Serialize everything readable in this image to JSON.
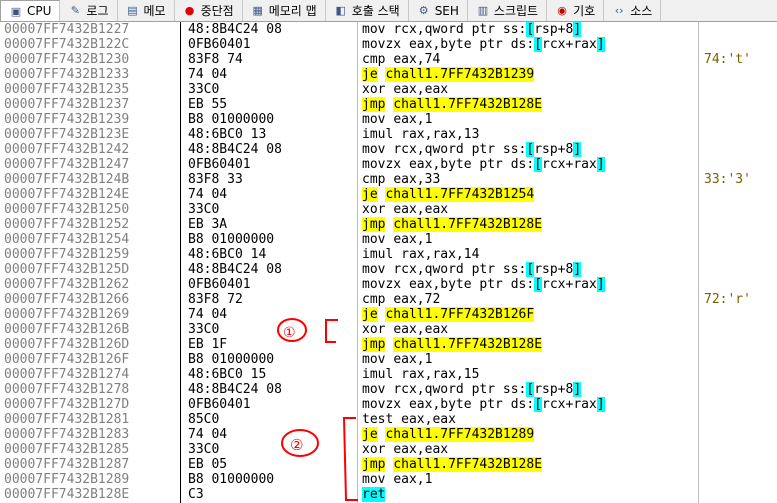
{
  "tabs": [
    {
      "label": "CPU",
      "icon": "cpu-icon",
      "active": true
    },
    {
      "label": "로그",
      "icon": "log-icon"
    },
    {
      "label": "메모",
      "icon": "notes-icon"
    },
    {
      "label": "중단점",
      "icon": "breakpoint-icon"
    },
    {
      "label": "메모리 맵",
      "icon": "memory-map-icon"
    },
    {
      "label": "호출 스택",
      "icon": "call-stack-icon"
    },
    {
      "label": "SEH",
      "icon": "seh-icon"
    },
    {
      "label": "스크립트",
      "icon": "script-icon"
    },
    {
      "label": "기호",
      "icon": "symbols-icon"
    },
    {
      "label": "소스",
      "icon": "source-icon"
    }
  ],
  "colors": {
    "highlight": "#ffff00",
    "bracket": "#00ffff",
    "annotation": "#ff0000"
  },
  "annotations": {
    "mark1": "①",
    "mark2": "②"
  },
  "rows": [
    {
      "addr": "00007FF7432B1227",
      "bytes": "48:8B4C24 08",
      "m": "mov",
      "ops": [
        [
          "rcx,qword ptr ss:",
          ""
        ],
        [
          "[",
          "br"
        ],
        [
          "rsp+8",
          ""
        ],
        [
          "]",
          "br"
        ]
      ],
      "cmt": ""
    },
    {
      "addr": "00007FF7432B122C",
      "bytes": "0FB60401",
      "m": "movzx",
      "ops": [
        [
          "eax,byte ptr ds:",
          ""
        ],
        [
          "[",
          "br"
        ],
        [
          "rcx+rax",
          ""
        ],
        [
          "]",
          "br"
        ]
      ],
      "cmt": ""
    },
    {
      "addr": "00007FF7432B1230",
      "bytes": "83F8 74",
      "m": "cmp",
      "ops": [
        [
          "eax,74",
          ""
        ]
      ],
      "cmt": "74:'t'"
    },
    {
      "addr": "00007FF7432B1233",
      "bytes": "74 04",
      "m": "je",
      "jmp": true,
      "ops": [
        [
          "chall1.7FF7432B1239",
          "tgt"
        ]
      ],
      "cmt": ""
    },
    {
      "addr": "00007FF7432B1235",
      "bytes": "33C0",
      "m": "xor",
      "ops": [
        [
          "eax,eax",
          ""
        ]
      ],
      "cmt": ""
    },
    {
      "addr": "00007FF7432B1237",
      "bytes": "EB 55",
      "m": "jmp",
      "jmp": true,
      "ops": [
        [
          "chall1.7FF7432B128E",
          "tgt"
        ]
      ],
      "cmt": ""
    },
    {
      "addr": "00007FF7432B1239",
      "bytes": "B8 01000000",
      "m": "mov",
      "ops": [
        [
          "eax,1",
          ""
        ]
      ],
      "cmt": ""
    },
    {
      "addr": "00007FF7432B123E",
      "bytes": "48:6BC0 13",
      "m": "imul",
      "ops": [
        [
          "rax,rax,13",
          ""
        ]
      ],
      "cmt": ""
    },
    {
      "addr": "00007FF7432B1242",
      "bytes": "48:8B4C24 08",
      "m": "mov",
      "ops": [
        [
          "rcx,qword ptr ss:",
          ""
        ],
        [
          "[",
          "br"
        ],
        [
          "rsp+8",
          ""
        ],
        [
          "]",
          "br"
        ]
      ],
      "cmt": ""
    },
    {
      "addr": "00007FF7432B1247",
      "bytes": "0FB60401",
      "m": "movzx",
      "ops": [
        [
          "eax,byte ptr ds:",
          ""
        ],
        [
          "[",
          "br"
        ],
        [
          "rcx+rax",
          ""
        ],
        [
          "]",
          "br"
        ]
      ],
      "cmt": ""
    },
    {
      "addr": "00007FF7432B124B",
      "bytes": "83F8 33",
      "m": "cmp",
      "ops": [
        [
          "eax,33",
          ""
        ]
      ],
      "cmt": "33:'3'"
    },
    {
      "addr": "00007FF7432B124E",
      "bytes": "74 04",
      "m": "je",
      "jmp": true,
      "ops": [
        [
          "chall1.7FF7432B1254",
          "tgt"
        ]
      ],
      "cmt": ""
    },
    {
      "addr": "00007FF7432B1250",
      "bytes": "33C0",
      "m": "xor",
      "ops": [
        [
          "eax,eax",
          ""
        ]
      ],
      "cmt": ""
    },
    {
      "addr": "00007FF7432B1252",
      "bytes": "EB 3A",
      "m": "jmp",
      "jmp": true,
      "ops": [
        [
          "chall1.7FF7432B128E",
          "tgt"
        ]
      ],
      "cmt": ""
    },
    {
      "addr": "00007FF7432B1254",
      "bytes": "B8 01000000",
      "m": "mov",
      "ops": [
        [
          "eax,1",
          ""
        ]
      ],
      "cmt": ""
    },
    {
      "addr": "00007FF7432B1259",
      "bytes": "48:6BC0 14",
      "m": "imul",
      "ops": [
        [
          "rax,rax,14",
          ""
        ]
      ],
      "cmt": ""
    },
    {
      "addr": "00007FF7432B125D",
      "bytes": "48:8B4C24 08",
      "m": "mov",
      "ops": [
        [
          "rcx,qword ptr ss:",
          ""
        ],
        [
          "[",
          "br"
        ],
        [
          "rsp+8",
          ""
        ],
        [
          "]",
          "br"
        ]
      ],
      "cmt": ""
    },
    {
      "addr": "00007FF7432B1262",
      "bytes": "0FB60401",
      "m": "movzx",
      "ops": [
        [
          "eax,byte ptr ds:",
          ""
        ],
        [
          "[",
          "br"
        ],
        [
          "rcx+rax",
          ""
        ],
        [
          "]",
          "br"
        ]
      ],
      "cmt": ""
    },
    {
      "addr": "00007FF7432B1266",
      "bytes": "83F8 72",
      "m": "cmp",
      "ops": [
        [
          "eax,72",
          ""
        ]
      ],
      "cmt": "72:'r'"
    },
    {
      "addr": "00007FF7432B1269",
      "bytes": "74 04",
      "m": "je",
      "jmp": true,
      "ops": [
        [
          "chall1.7FF7432B126F",
          "tgt"
        ]
      ],
      "cmt": ""
    },
    {
      "addr": "00007FF7432B126B",
      "bytes": "33C0",
      "m": "xor",
      "ops": [
        [
          "eax,eax",
          ""
        ]
      ],
      "cmt": ""
    },
    {
      "addr": "00007FF7432B126D",
      "bytes": "EB 1F",
      "m": "jmp",
      "jmp": true,
      "ops": [
        [
          "chall1.7FF7432B128E",
          "tgt"
        ]
      ],
      "cmt": ""
    },
    {
      "addr": "00007FF7432B126F",
      "bytes": "B8 01000000",
      "m": "mov",
      "ops": [
        [
          "eax,1",
          ""
        ]
      ],
      "cmt": ""
    },
    {
      "addr": "00007FF7432B1274",
      "bytes": "48:6BC0 15",
      "m": "imul",
      "ops": [
        [
          "rax,rax,15",
          ""
        ]
      ],
      "cmt": ""
    },
    {
      "addr": "00007FF7432B1278",
      "bytes": "48:8B4C24 08",
      "m": "mov",
      "ops": [
        [
          "rcx,qword ptr ss:",
          ""
        ],
        [
          "[",
          "br"
        ],
        [
          "rsp+8",
          ""
        ],
        [
          "]",
          "br"
        ]
      ],
      "cmt": ""
    },
    {
      "addr": "00007FF7432B127D",
      "bytes": "0FB60401",
      "m": "movzx",
      "ops": [
        [
          "eax,byte ptr ds:",
          ""
        ],
        [
          "[",
          "br"
        ],
        [
          "rcx+rax",
          ""
        ],
        [
          "]",
          "br"
        ]
      ],
      "cmt": ""
    },
    {
      "addr": "00007FF7432B1281",
      "bytes": "85C0",
      "m": "test",
      "ops": [
        [
          "eax,eax",
          ""
        ]
      ],
      "cmt": ""
    },
    {
      "addr": "00007FF7432B1283",
      "bytes": "74 04",
      "m": "je",
      "jmp": true,
      "ops": [
        [
          "chall1.7FF7432B1289",
          "tgt"
        ]
      ],
      "cmt": ""
    },
    {
      "addr": "00007FF7432B1285",
      "bytes": "33C0",
      "m": "xor",
      "ops": [
        [
          "eax,eax",
          ""
        ]
      ],
      "cmt": ""
    },
    {
      "addr": "00007FF7432B1287",
      "bytes": "EB 05",
      "m": "jmp",
      "jmp": true,
      "ops": [
        [
          "chall1.7FF7432B128E",
          "tgt"
        ]
      ],
      "cmt": ""
    },
    {
      "addr": "00007FF7432B1289",
      "bytes": "B8 01000000",
      "m": "mov",
      "ops": [
        [
          "eax,1",
          ""
        ]
      ],
      "cmt": ""
    },
    {
      "addr": "00007FF7432B128E",
      "bytes": "C3",
      "m": "ret",
      "ret": true,
      "ops": [],
      "cmt": ""
    }
  ]
}
